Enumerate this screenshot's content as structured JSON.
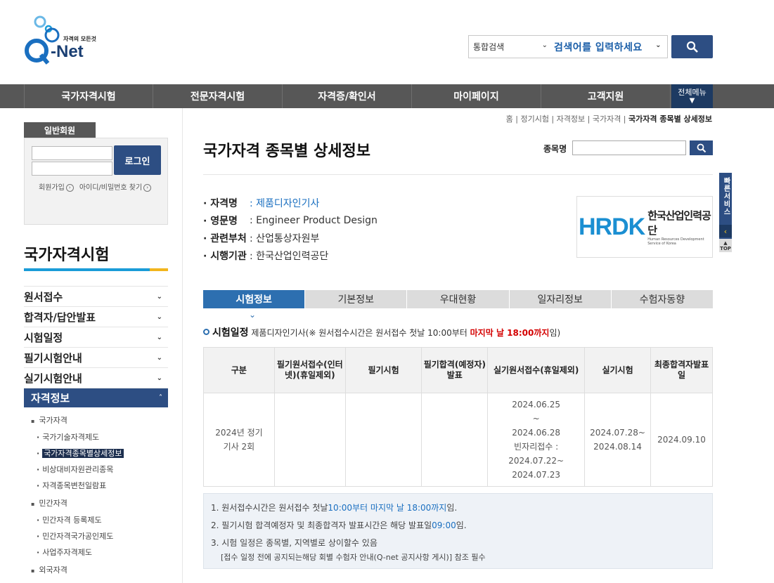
{
  "logo": {
    "tagline": "자격의 모든것",
    "name": "-Net",
    "letter": "Q"
  },
  "search": {
    "category": "통합검색",
    "placeholder": "검색어를 입력하세요"
  },
  "gnb": {
    "items": [
      "국가자격시험",
      "전문자격시험",
      "자격증/확인서",
      "마이페이지",
      "고객지원"
    ],
    "all_menu": "전체메뉴"
  },
  "member": {
    "tab": "일반회원",
    "login": "로그인",
    "join": "회원가입",
    "find": "아이디/비밀번호 찾기"
  },
  "lnb": {
    "title": "국가자격시험",
    "items": [
      "원서접수",
      "합격자/답안발표",
      "시험일정",
      "필기시험안내",
      "실기시험안내",
      "자격정보"
    ],
    "sub": {
      "national": "국가자격",
      "n1": "국가기술자격제도",
      "n2": "국가자격종목별상세정보",
      "n3": "비상대비자원관리종목",
      "n4": "자격종목변천일람표",
      "private": "민간자격",
      "p1": "민간자격 등록제도",
      "p2": "민간자격국가공인제도",
      "p3": "사업주자격제도",
      "foreign": "외국자격"
    }
  },
  "breadcrumb": [
    "홈",
    "정기시험",
    "자격정보",
    "국가자격",
    "국가자격 종목별 상세정보"
  ],
  "page": {
    "title": "국가자격 종목별 상세정보",
    "search_label": "종목명"
  },
  "info": {
    "k1": "· 자격명",
    "v1": ": 제품디자인기사",
    "k2": "· 영문명",
    "v2": ": Engineer Product Design",
    "k3": "· 관련부처",
    "v3": ": 산업통상자원부",
    "k4": "· 시행기관",
    "v4": ": 한국산업인력공단"
  },
  "hrdk": {
    "mark": "HRDK",
    "ko": "한국산업인력공단",
    "en": "Human Resources Development Service of Korea"
  },
  "quick": {
    "label": "빠른서비스",
    "top": "TOP"
  },
  "tabs": [
    "시험정보",
    "기본정보",
    "우대현황",
    "일자리정보",
    "수험자동향"
  ],
  "schedule": {
    "title": "시험일정",
    "item": "제품디자인기사",
    "note_pre": "(※ 원서접수시간은 원서접수 첫날 10:00부터 ",
    "note_red": "마지막 날 18:00까지",
    "note_post": "임)",
    "headers": [
      "구분",
      "필기원서접수(인터넷)(휴일제외)",
      "필기시험",
      "필기합격(예정자)발표",
      "실기원서접수(휴일제외)",
      "실기시험",
      "최종합격자발표일"
    ],
    "row": {
      "c0": "2024년 정기기사 2회",
      "c1": "",
      "c2": "",
      "c3": "",
      "c4a": "2024.06.25",
      "c4b": "~",
      "c4c": "2024.06.28",
      "c4d": "빈자리접수 :",
      "c4e": "2024.07.22~",
      "c4f": "2024.07.23",
      "c5a": "2024.07.28~",
      "c5b": "2024.08.14",
      "c6": "2024.09.10"
    }
  },
  "notes": {
    "n1_pre": "1. 원서접수시간은 원서접수 첫날 ",
    "n1_blue": "10:00부터 마지막 날 18:00까지",
    "n1_post": " 임.",
    "n2_pre": "2. 필기시험 합격예정자 및 최종합격자 발표시간은 해당 발표일 ",
    "n2_blue": "09:00",
    "n2_post": "임.",
    "n3": "3. 시험 일정은 종목별, 지역별로 상이할수 있음",
    "n3_sub": "[접수 일정 전에 공지되는해당 회별 수험자 안내(Q-net 공지사항 게시)] 참조 필수"
  }
}
